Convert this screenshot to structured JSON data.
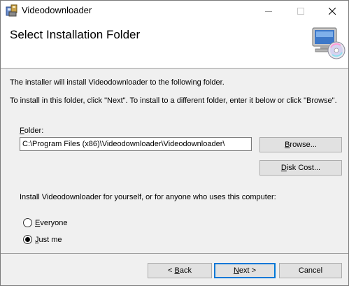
{
  "window": {
    "title": "Videodownloader",
    "minimize_glyph": "—",
    "maximize_glyph": "☐",
    "close_glyph": "✕"
  },
  "header": {
    "title": "Select Installation Folder"
  },
  "body": {
    "line1": "The installer will install Videodownloader to the following folder.",
    "line2": "To install in this folder, click \"Next\". To install to a different folder, enter it below or click \"Browse\"."
  },
  "folder": {
    "label_accel": "F",
    "label_rest": "older:",
    "value": "C:\\Program Files (x86)\\Videodownloader\\Videodownloader\\"
  },
  "buttons": {
    "browse_accel": "B",
    "browse_rest": "rowse...",
    "diskcost_pre": "",
    "diskcost_accel": "D",
    "diskcost_rest": "isk Cost...",
    "back_pre": "< ",
    "back_accel": "B",
    "back_rest": "ack",
    "next_accel": "N",
    "next_rest": "ext >",
    "cancel": "Cancel"
  },
  "install_for": {
    "question": "Install Videodownloader for yourself, or for anyone who uses this computer:",
    "options": [
      {
        "accel": "E",
        "rest": "veryone",
        "checked": false
      },
      {
        "accel": "J",
        "rest": "ust me",
        "checked": true
      }
    ]
  },
  "colors": {
    "accent": "#0078d7",
    "dialog_bg": "#f0f0f0"
  }
}
